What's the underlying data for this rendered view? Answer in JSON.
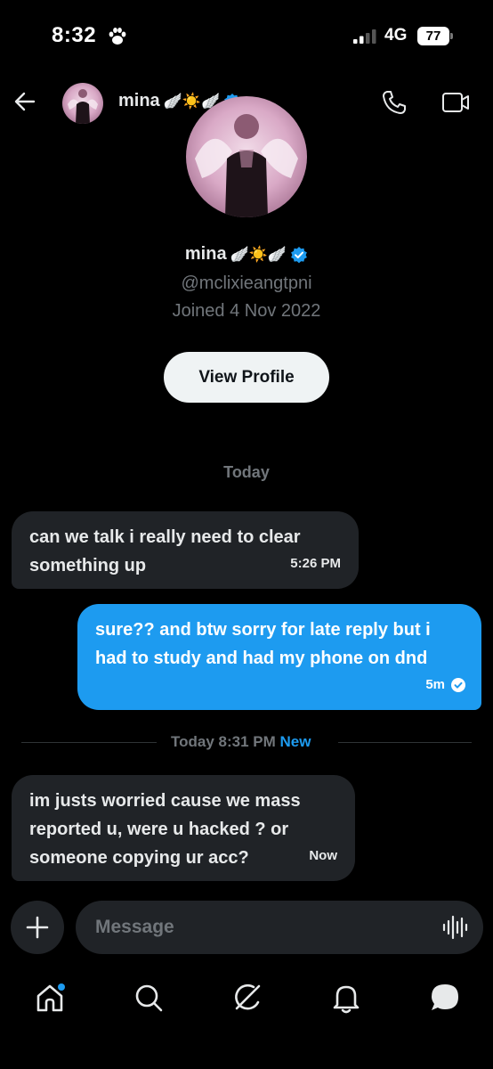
{
  "status_bar": {
    "time": "8:32",
    "network": "4G",
    "battery": "77"
  },
  "header": {
    "name": "mina",
    "emoji": "🪽☀️🪽"
  },
  "profile": {
    "name": "mina",
    "emoji": "🪽☀️🪽",
    "handle": "@mclixieangtpni",
    "joined": "Joined 4 Nov 2022",
    "view_profile_label": "View Profile"
  },
  "conversation": {
    "day_label": "Today",
    "messages": [
      {
        "direction": "incoming",
        "text": "can we talk i really need to clear something up",
        "time": "5:26 PM"
      },
      {
        "direction": "outgoing",
        "text": "sure?? and btw sorry for late reply but i had to study and had my phone on dnd",
        "time": "5m"
      },
      {
        "direction": "incoming",
        "text": "im justs worried cause we mass reported u, were u hacked ? or someone copying ur acc?",
        "time": "Now"
      }
    ],
    "new_divider": {
      "label": "Today 8:31 PM",
      "new_label": "New"
    }
  },
  "composer": {
    "placeholder": "Message"
  },
  "colors": {
    "background": "#000000",
    "incoming_bubble": "#202327",
    "outgoing_bubble": "#1d9bf0",
    "accent": "#1d9bf0",
    "muted_text": "#71767b",
    "verified": "#1d9bf0"
  },
  "icons": {
    "status": [
      "paw-icon",
      "signal-icon",
      "battery-icon"
    ],
    "header": [
      "back-arrow-icon",
      "phone-call-icon",
      "video-call-icon"
    ],
    "composer": [
      "plus-icon",
      "voice-waveform-icon"
    ],
    "bottom_nav": [
      "home-icon",
      "search-icon",
      "grok-icon",
      "notifications-bell-icon",
      "messages-icon"
    ]
  }
}
